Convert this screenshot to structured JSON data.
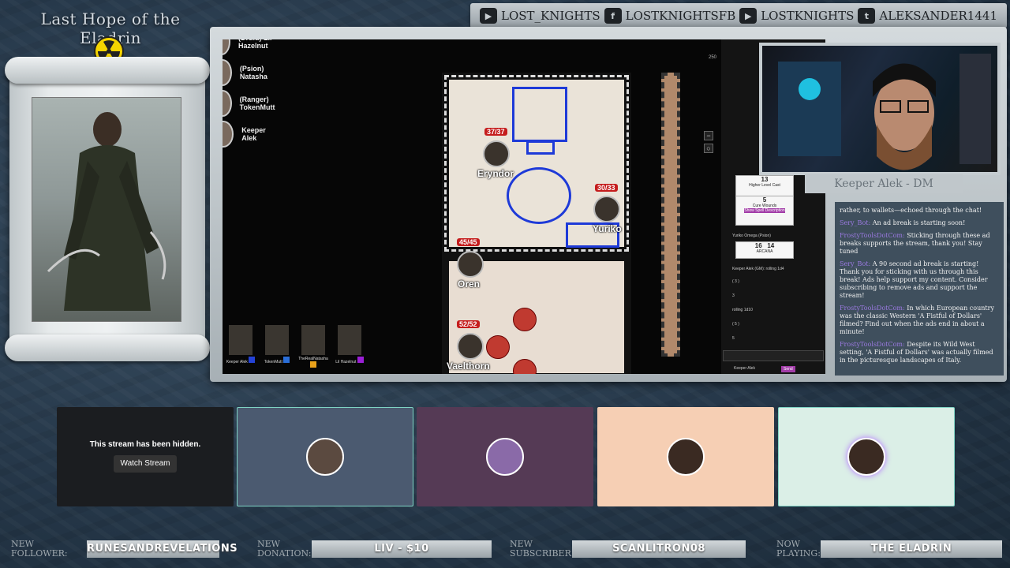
{
  "campaign_title": "Last Hope of the Eladrin",
  "socials": [
    {
      "icon": "twitch-icon",
      "glyph": "▶",
      "label": "LOST_KNIGHTS"
    },
    {
      "icon": "facebook-icon",
      "glyph": "f",
      "label": "LOSTKNIGHTSFB"
    },
    {
      "icon": "youtube-icon",
      "glyph": "▶",
      "label": "LOSTKNIGHTS"
    },
    {
      "icon": "twitter-icon",
      "glyph": "t",
      "label": "ALEKSANDER1441"
    }
  ],
  "party": [
    "(Druid) Lil Hazelnut",
    "(Psion) Natasha",
    "(Ranger) TokenMutt",
    "Keeper Alek"
  ],
  "tokens": [
    {
      "name": "Eryndor",
      "hp": "37/37"
    },
    {
      "name": "Yuriko",
      "hp": "30/33"
    },
    {
      "name": "Oren",
      "hp": "45/45"
    },
    {
      "name": "Vaelthorn",
      "hp": "52/52"
    }
  ],
  "map_scale": "250",
  "hotbar": [
    "Keeper Alek",
    "TokenMutt",
    "TheRealNatasha",
    "Lil Hazelnut"
  ],
  "hotbar_colors": [
    "#2442d6",
    "#2a6ed8",
    "#e8a11a",
    "#9b1fd6"
  ],
  "sheet": {
    "level_cast_value": "13",
    "level_cast_label": "Higher Level Cast",
    "cure_value": "5",
    "cure_label": "Cure Wounds",
    "cure_button": "Show Spell Description",
    "yuriko_header": "Yuriko Omega (Psion)",
    "arcana_vals": [
      "16",
      "14"
    ],
    "arcana_label": "ARCANA",
    "keeper_roll": "Keeper Alek (GM): rolling 1d4",
    "rolls": [
      "( 3 )",
      "3",
      "rolling 1d10",
      "( 5 )",
      "5"
    ],
    "as_label": "Keeper Alek",
    "send_label": "Send"
  },
  "cam_label": "Keeper Alek - DM",
  "chat": [
    {
      "user": "",
      "text": "rather, to wallets—echoed through the chat!"
    },
    {
      "user": "Sery_Bot:",
      "text": "An ad break is starting soon!"
    },
    {
      "user": "FrostyToolsDotCom:",
      "text": "Sticking through these ad breaks supports the stream, thank you! Stay tuned"
    },
    {
      "user": "Sery_Bot:",
      "text": "A 90 second ad break is starting! Thank you for sticking with us through this break! Ads help support my content. Consider subscribing to remove ads and support the stream!"
    },
    {
      "user": "FrostyToolsDotCom:",
      "text": "In which European country was the classic Western 'A Fistful of Dollars' filmed? Find out when the ads end in about a minute!"
    },
    {
      "user": "FrostyToolsDotCom:",
      "text": "Despite its Wild West setting, 'A Fistful of Dollars' was actually filmed in the picturesque landscapes of Italy."
    }
  ],
  "tiles": [
    {
      "hidden_text": "This stream has been hidden.",
      "button": "Watch Stream",
      "bg": "#1b1d20"
    },
    {
      "bg": "#4b5a70"
    },
    {
      "bg": "#553a55"
    },
    {
      "bg": "#f6cfb4"
    },
    {
      "bg": "#dbefe7"
    }
  ],
  "ticker": [
    {
      "label": "NEW FOLLOWER:",
      "value": "RUNESANDREVELATIONS"
    },
    {
      "label": "NEW DONATION:",
      "value": "LIV - $10"
    },
    {
      "label": "NEW SUBSCRIBER:",
      "value": "SCANLITRON08"
    },
    {
      "label": "NOW PLAYING:",
      "value": "THE ELADRIN"
    }
  ]
}
